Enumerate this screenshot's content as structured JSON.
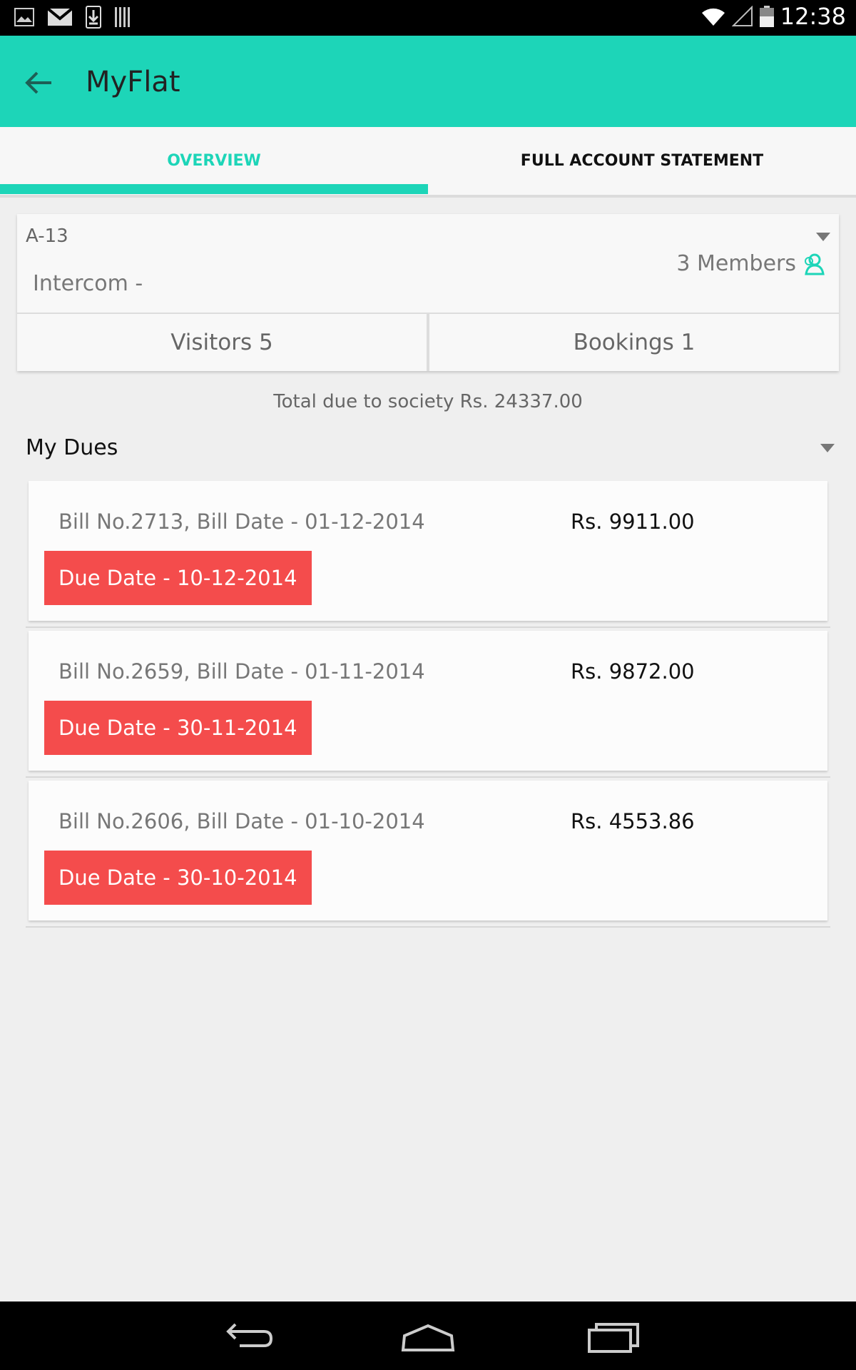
{
  "status_bar": {
    "time": "12:38",
    "left_icons": [
      "image-icon",
      "gmail-icon",
      "download-icon",
      "barcode-icon"
    ],
    "right_icons": [
      "wifi-icon",
      "signal-icon",
      "battery-icon"
    ]
  },
  "app_bar": {
    "title": "MyFlat",
    "back_icon": "arrow-left-icon",
    "color": "#1dd5b8"
  },
  "tabs": [
    {
      "label": "OVERVIEW",
      "active": true
    },
    {
      "label": "FULL ACCOUNT STATEMENT",
      "active": false
    }
  ],
  "flat": {
    "number": "A-13",
    "intercom": "Intercom -",
    "members": "3 Members",
    "visitors": "Visitors 5",
    "bookings": "Bookings 1"
  },
  "total_due": "Total due to society Rs. 24337.00",
  "dues": {
    "title": "My Dues",
    "bills": [
      {
        "info": "Bill No.2713, Bill Date - 01-12-2014",
        "amount": "Rs. 9911.00",
        "due_date": "Due Date - 10-12-2014"
      },
      {
        "info": "Bill No.2659, Bill Date - 01-11-2014",
        "amount": "Rs. 9872.00",
        "due_date": "Due Date - 30-11-2014"
      },
      {
        "info": "Bill No.2606, Bill Date - 01-10-2014",
        "amount": "Rs. 4553.86",
        "due_date": "Due Date - 30-10-2014"
      }
    ]
  },
  "colors": {
    "accent": "#1dd5b8",
    "due_badge": "#f44c4c"
  },
  "nav_bar": [
    "back-nav-icon",
    "home-nav-icon",
    "recents-nav-icon"
  ]
}
